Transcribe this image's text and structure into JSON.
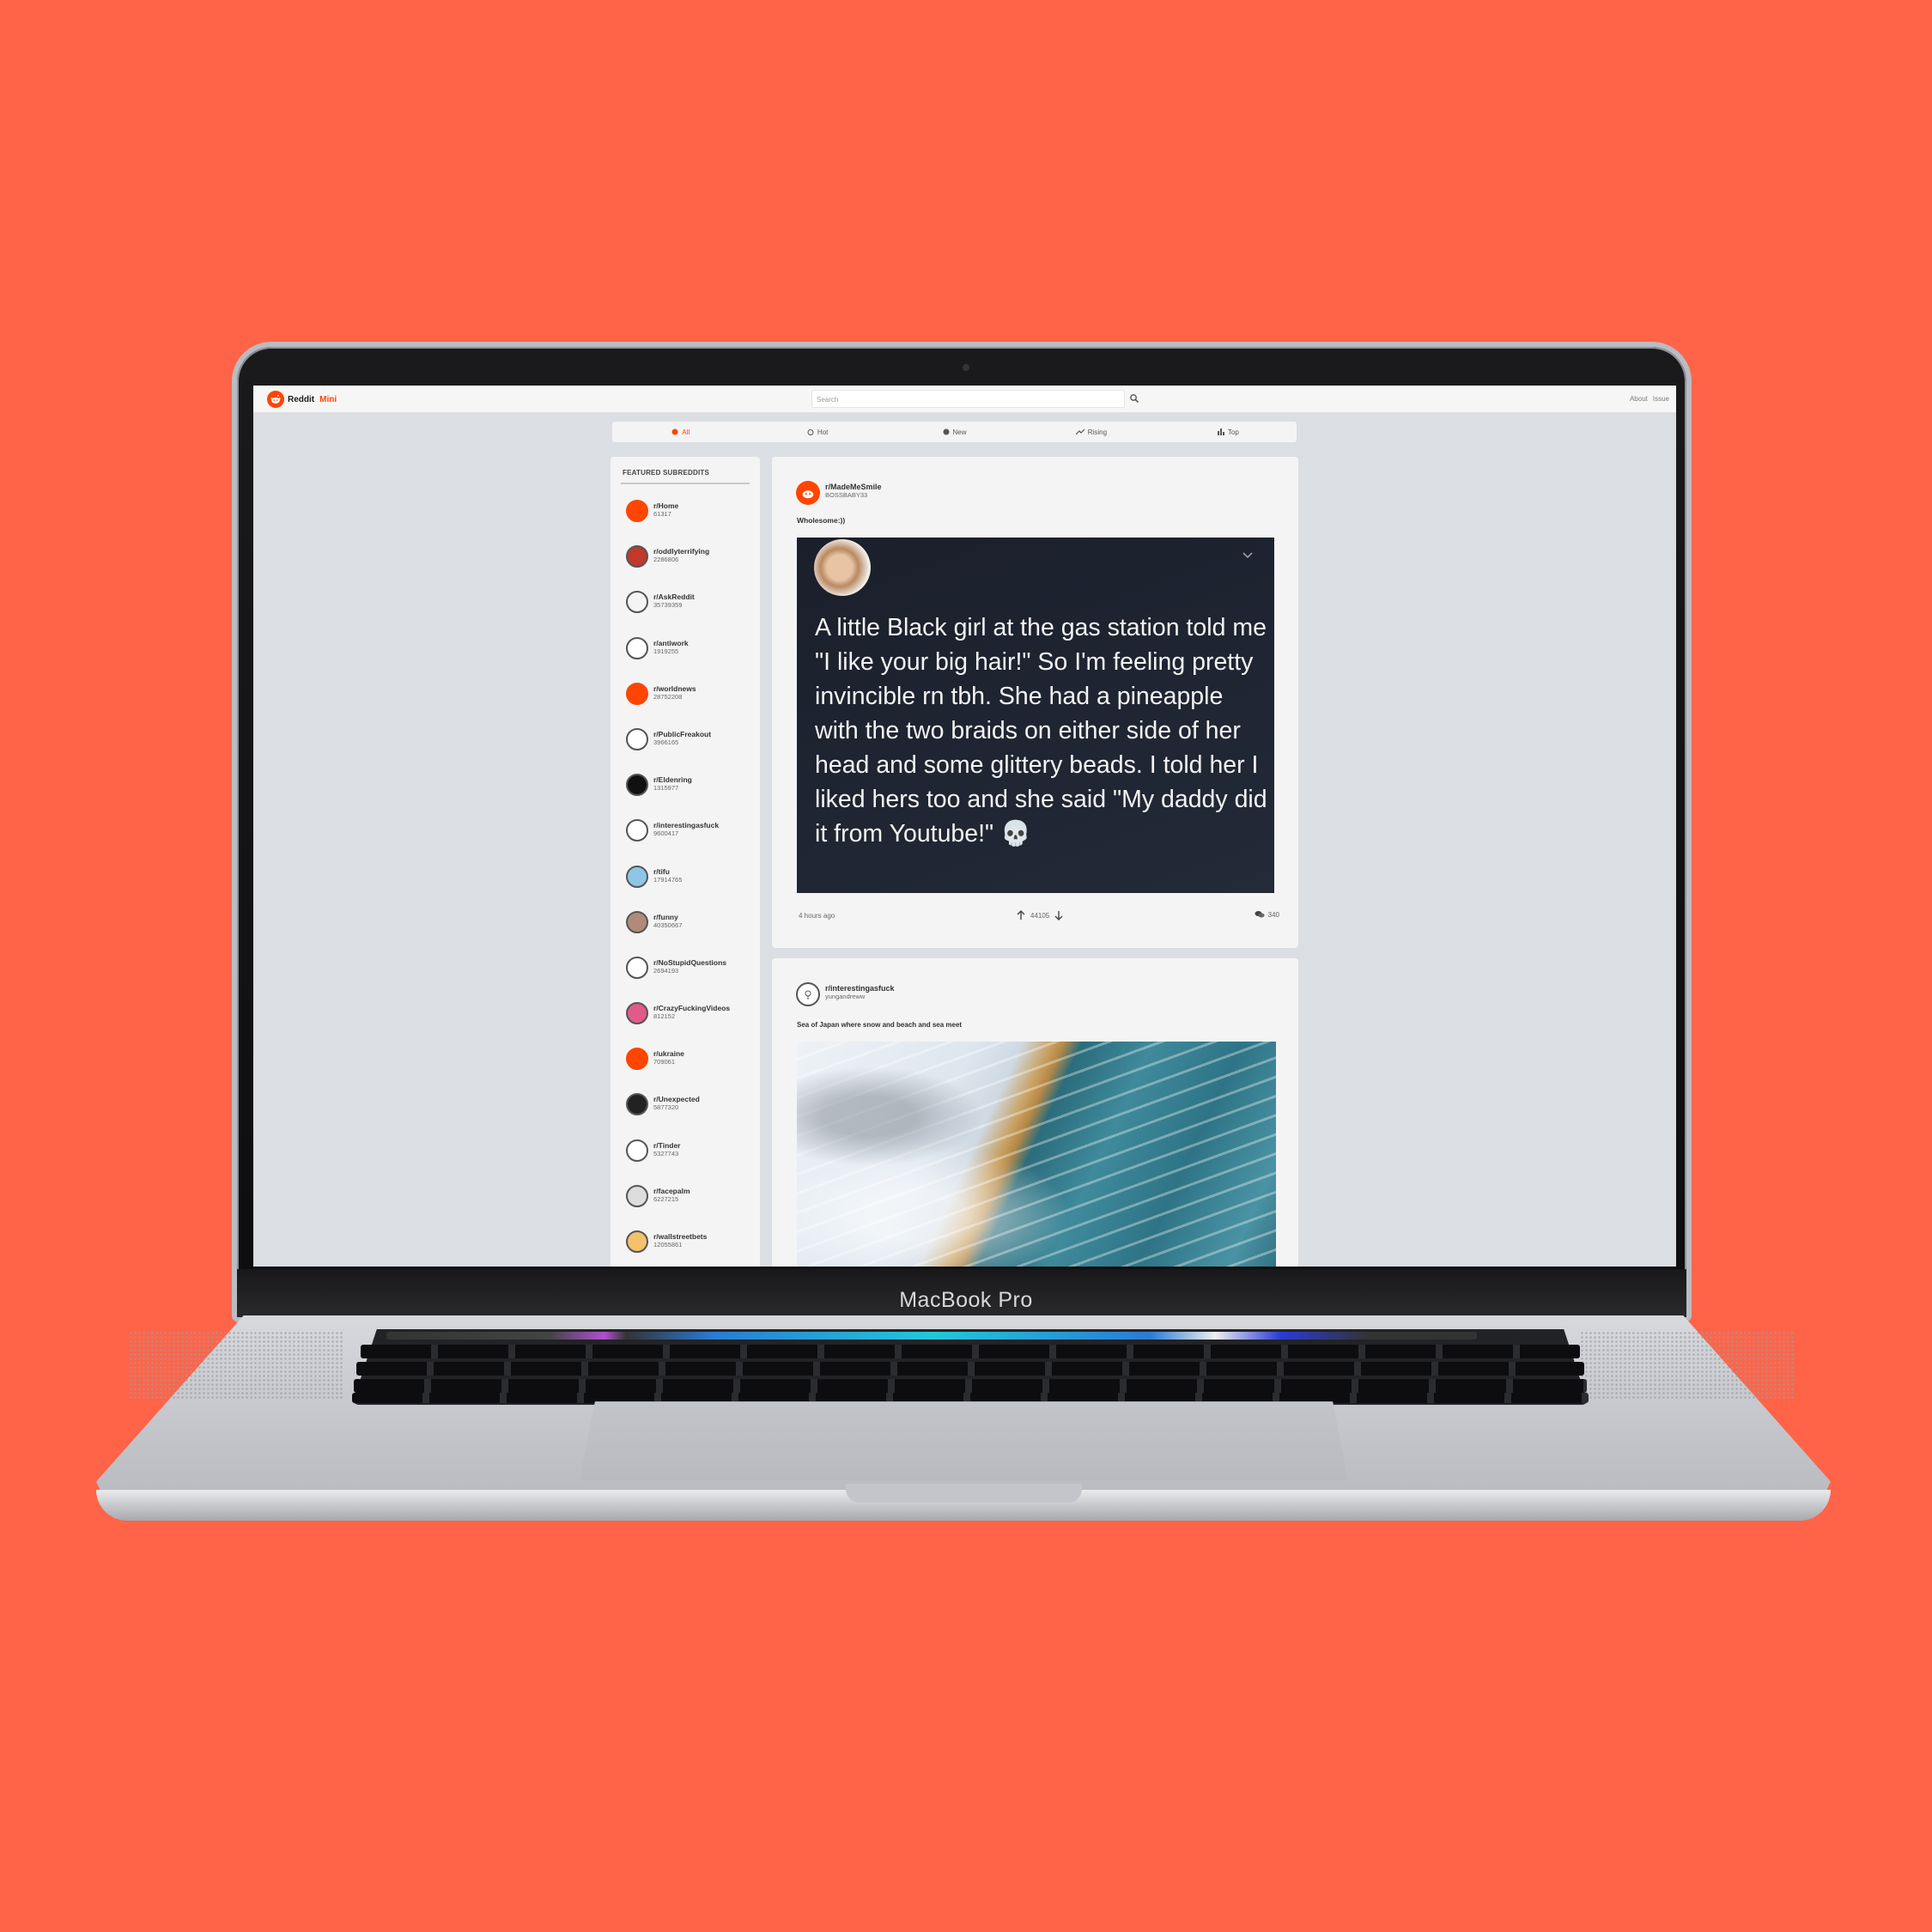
{
  "device": {
    "label": "MacBook Pro"
  },
  "app": {
    "brand": "Reddit",
    "brand_accent": "Mini",
    "search_placeholder": "Search",
    "links": [
      "About",
      "Issue"
    ]
  },
  "sort_tabs": [
    {
      "label": "All",
      "icon": "globe-icon",
      "active": true
    },
    {
      "label": "Hot",
      "icon": "flame-icon",
      "active": false
    },
    {
      "label": "New",
      "icon": "new-icon",
      "active": false
    },
    {
      "label": "Rising",
      "icon": "trending-icon",
      "active": false
    },
    {
      "label": "Top",
      "icon": "bar-chart-icon",
      "active": false
    }
  ],
  "sidebar": {
    "title": "FEATURED SUBREDDITS",
    "items": [
      {
        "name": "r/Home",
        "count": "61317"
      },
      {
        "name": "r/oddlyterrifying",
        "count": "2286806"
      },
      {
        "name": "r/AskReddit",
        "count": "35739359"
      },
      {
        "name": "r/antiwork",
        "count": "1919255"
      },
      {
        "name": "r/worldnews",
        "count": "28752208"
      },
      {
        "name": "r/PublicFreakout",
        "count": "3966165"
      },
      {
        "name": "r/Eldenring",
        "count": "1315977"
      },
      {
        "name": "r/interestingasfuck",
        "count": "9600417"
      },
      {
        "name": "r/tifu",
        "count": "17914765"
      },
      {
        "name": "r/funny",
        "count": "40350667"
      },
      {
        "name": "r/NoStupidQuestions",
        "count": "2694193"
      },
      {
        "name": "r/CrazyFuckingVideos",
        "count": "812152"
      },
      {
        "name": "r/ukraine",
        "count": "709061"
      },
      {
        "name": "r/Unexpected",
        "count": "5877320"
      },
      {
        "name": "r/Tinder",
        "count": "5327743"
      },
      {
        "name": "r/facepalm",
        "count": "6227215"
      },
      {
        "name": "r/wallstreetbets",
        "count": "12055861"
      }
    ]
  },
  "colors": {
    "accent": "#ff4500",
    "background": "#ff6448"
  },
  "posts": [
    {
      "subreddit": "r/MadeMeSmile",
      "author": "BOSSBABY33",
      "title": "Wholesome:))",
      "image_text": "A little Black girl at the gas station told me \"I like your big hair!\" So I'm feeling pretty invincible rn tbh. She had a pineapple with the two braids on either side of her head and some glittery beads. I told her I liked hers too and she said \"My daddy did it from Youtube!\" 💀",
      "time": "4 hours ago",
      "votes": "44105",
      "comments": "340"
    },
    {
      "subreddit": "r/interestingasfuck",
      "author": "yungandreww",
      "title": "Sea of Japan where snow and beach and sea meet"
    }
  ]
}
